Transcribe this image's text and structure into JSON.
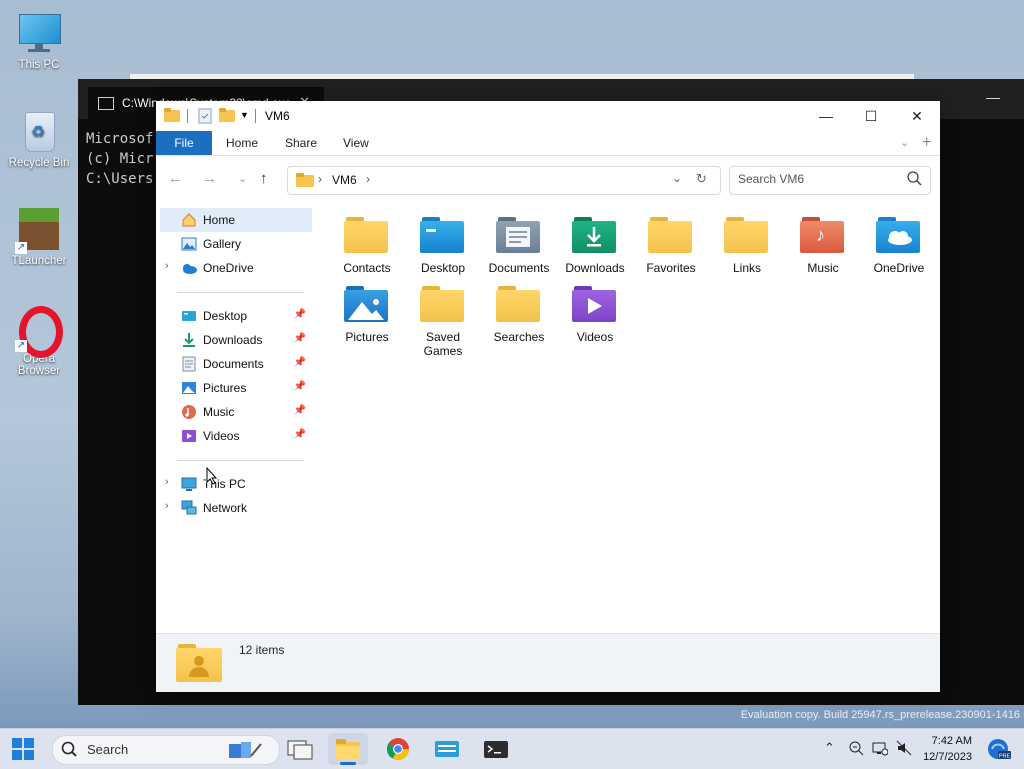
{
  "desktop": {
    "icons": [
      {
        "label": "This PC"
      },
      {
        "label": "Recycle Bin"
      },
      {
        "label": "TLauncher"
      },
      {
        "label": "Opera Browser"
      }
    ]
  },
  "terminal": {
    "tab_title": "C:\\Windows\\System32\\cmd.exe",
    "lines": [
      "Microsof",
      "(c) Micr",
      "",
      "C:\\Users"
    ]
  },
  "explorer": {
    "title": "VM6",
    "ribbon_tabs": [
      "File",
      "Home",
      "Share",
      "View"
    ],
    "address": {
      "path": "VM6"
    },
    "search": {
      "placeholder": "Search VM6"
    },
    "nav": {
      "home": "Home",
      "gallery": "Gallery",
      "onedrive": "OneDrive",
      "quick": [
        "Desktop",
        "Downloads",
        "Documents",
        "Pictures",
        "Music",
        "Videos"
      ],
      "thispc": "This PC",
      "network": "Network"
    },
    "items": [
      "Contacts",
      "Desktop",
      "Documents",
      "Downloads",
      "Favorites",
      "Links",
      "Music",
      "OneDrive",
      "Pictures",
      "Saved Games",
      "Searches",
      "Videos"
    ],
    "status": {
      "count": "12 items"
    }
  },
  "taskbar": {
    "search_label": "Search",
    "time": "7:42 AM",
    "date": "12/7/2023"
  },
  "watermark": "Evaluation copy. Build 25947.rs_prerelease.230901-1416"
}
